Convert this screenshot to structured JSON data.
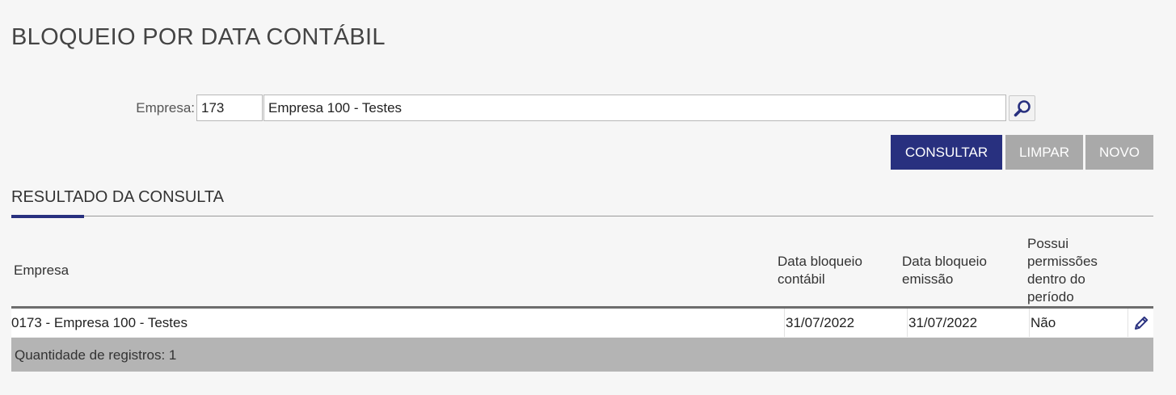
{
  "page": {
    "title": "BLOQUEIO POR DATA CONTÁBIL"
  },
  "colors": {
    "primary": "#28307f",
    "disabled": "#a9a9a9"
  },
  "filter": {
    "label": "Empresa:",
    "code_value": "173",
    "name_value": "Empresa 100 - Testes",
    "search_icon": "magnifier-icon"
  },
  "actions": {
    "consultar": "CONSULTAR",
    "limpar": "LIMPAR",
    "novo": "NOVO"
  },
  "results": {
    "title": "RESULTADO DA CONSULTA",
    "columns": {
      "empresa": "Empresa",
      "contabil_1": "Data bloqueio",
      "contabil_2": "contábil",
      "emissao_1": "Data bloqueio",
      "emissao_2": "emissão",
      "perm_1": "Possui",
      "perm_2": "permissões",
      "perm_3": "dentro do",
      "perm_4": "período"
    },
    "rows": [
      {
        "empresa": "0173 - Empresa 100 - Testes",
        "data_contabil": "31/07/2022",
        "data_emissao": "31/07/2022",
        "permissoes": "Não",
        "action_icon": "pencil-icon"
      }
    ],
    "footer": "Quantidade de registros: 1"
  }
}
